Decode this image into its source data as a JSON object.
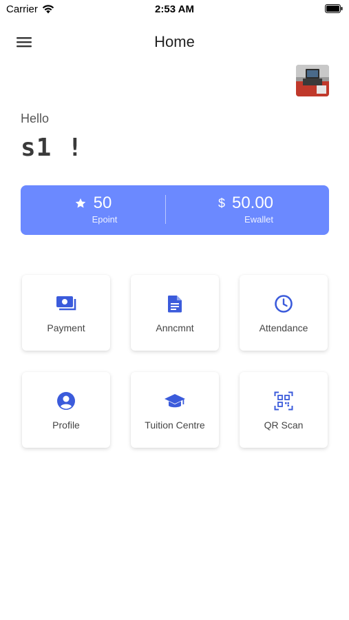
{
  "status_bar": {
    "carrier": "Carrier",
    "time": "2:53 AM"
  },
  "nav": {
    "title": "Home",
    "menu_icon": "menu-icon"
  },
  "greeting": {
    "hello": "Hello",
    "username": "s1 !"
  },
  "balance": {
    "epoint": {
      "value": "50",
      "label": "Epoint",
      "icon": "star-icon"
    },
    "ewallet": {
      "value": "50.00",
      "label": "Ewallet",
      "icon": "dollar-icon"
    }
  },
  "tiles": [
    {
      "label": "Payment",
      "icon": "payment-icon"
    },
    {
      "label": "Anncmnt",
      "icon": "announcement-icon"
    },
    {
      "label": "Attendance",
      "icon": "clock-icon"
    },
    {
      "label": "Profile",
      "icon": "profile-icon"
    },
    {
      "label": "Tuition Centre",
      "icon": "graduation-cap-icon"
    },
    {
      "label": "QR Scan",
      "icon": "qr-scan-icon"
    }
  ],
  "colors": {
    "accent": "#6b89ff",
    "icon_blue": "#3b5bdb"
  }
}
